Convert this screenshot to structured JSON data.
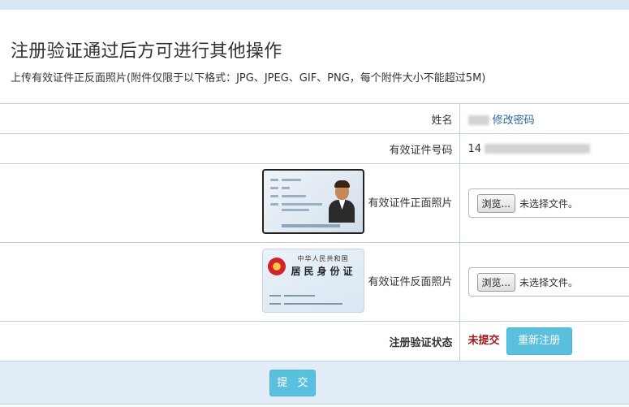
{
  "page": {
    "title": "注册验证通过后方可进行其他操作",
    "subtitle": "上传有效证件正反面照片(附件仅限于以下格式：JPG、JPEG、GIF、PNG，每个附件大小不能超过5M)"
  },
  "form": {
    "name": {
      "label": "姓名",
      "change_password_link": "修改密码"
    },
    "id_number": {
      "label": "有效证件号码",
      "value_prefix": "14"
    },
    "front_photo": {
      "label": "有效证件正面照片",
      "browse": "浏览...",
      "status": "未选择文件。"
    },
    "back_photo": {
      "label": "有效证件反面照片",
      "browse": "浏览...",
      "status": "未选择文件。"
    },
    "verify_status": {
      "label": "注册验证状态",
      "value": "未提交",
      "reregister_button": "重新注册"
    },
    "submit_button": "提 交"
  },
  "id_card_back": {
    "line1": "中华人民共和国",
    "line2": "居民身份证"
  },
  "colors": {
    "accent_button": "#5bc0de",
    "status_red": "#a01a1a",
    "link": "#2a6496",
    "border": "#bcd3e6",
    "submit_row_bg": "#e1ecf7"
  }
}
